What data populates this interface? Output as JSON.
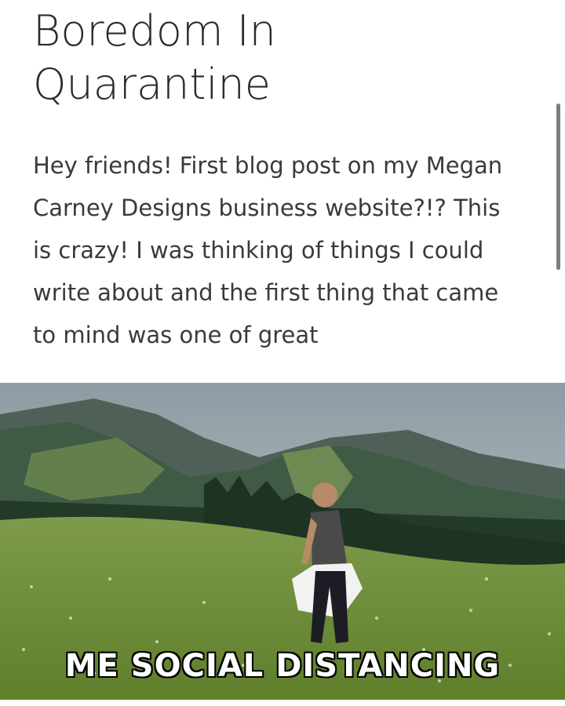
{
  "post": {
    "title_lines": [
      "Boredom In",
      "Quarantine"
    ],
    "body_lines": [
      "Hey friends! First blog post on my Megan",
      "Carney Designs business website?!? This",
      "is crazy! I was thinking of things I could",
      "write about and the first thing that came",
      "to mind was one of great"
    ]
  },
  "image": {
    "caption": "ME SOCIAL DISTANCING"
  },
  "colors": {
    "text": "#2b2b2b",
    "body_text": "#3a3a3a",
    "scrollbar": "#7d7d7d"
  }
}
